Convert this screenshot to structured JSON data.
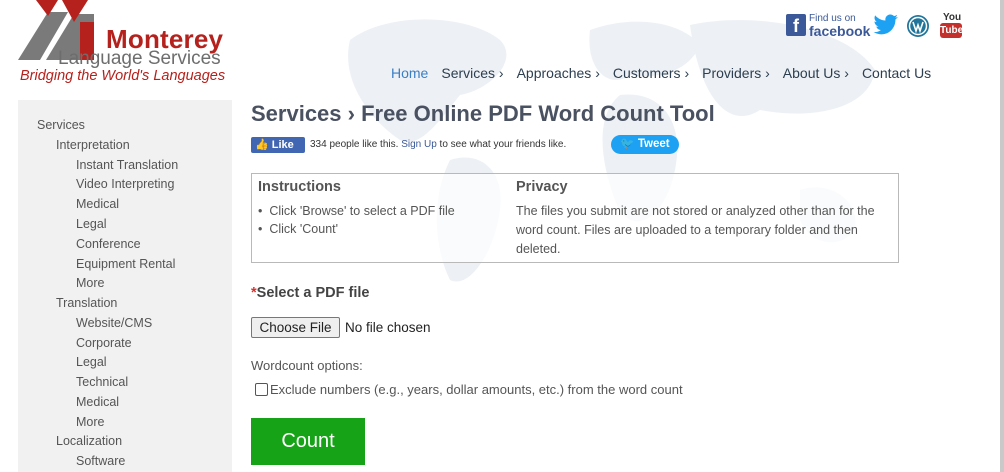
{
  "logo": {
    "title": "Monterey",
    "subtitle": "Language Services",
    "tagline": "Bridging the World's Languages"
  },
  "social": {
    "facebook_find": "Find us on",
    "facebook_name": "facebook",
    "youtube_you": "You",
    "youtube_tube": "Tube"
  },
  "nav": {
    "items": [
      "Home",
      "Services ›",
      "Approaches ›",
      "Customers ›",
      "Providers ›",
      "About Us ›",
      "Contact Us"
    ]
  },
  "sidebar": {
    "items": [
      "Services",
      "Interpretation",
      "Instant Translation",
      "Video Interpreting",
      "Medical",
      "Legal",
      "Conference",
      "Equipment Rental",
      "More",
      "Translation",
      "Website/CMS",
      "Corporate",
      "Legal",
      "Technical",
      "Medical",
      "More",
      "Localization",
      "Software"
    ]
  },
  "main": {
    "title": "Services › Free Online PDF Word Count Tool",
    "like_label": "Like",
    "like_text_pre": "334 people like this.",
    "like_signup": "Sign Up",
    "like_text_post": "to see what your friends like.",
    "tweet_label": "Tweet",
    "instructions_heading": "Instructions",
    "instructions": [
      "Click 'Browse' to select a PDF file",
      "Click 'Count'"
    ],
    "privacy_heading": "Privacy",
    "privacy_text": "The files you submit are not stored or analyzed other than for the word count. Files are uploaded to a temporary folder and then deleted.",
    "select_required_mark": "*",
    "select_label": "Select a PDF file",
    "choose_file_label": "Choose File",
    "no_file_text": "No file chosen",
    "wordcount_label": "Wordcount options:",
    "exclude_label": "Exclude numbers (e.g., years, dollar amounts, etc.) from the word count",
    "exclude_checked": false,
    "count_label": "Count"
  },
  "colors": {
    "brand_red": "#b5221d",
    "nav_active": "#3a7ec4",
    "count_green": "#17a317",
    "facebook_blue": "#3b5998",
    "twitter_blue": "#1da1f2"
  }
}
